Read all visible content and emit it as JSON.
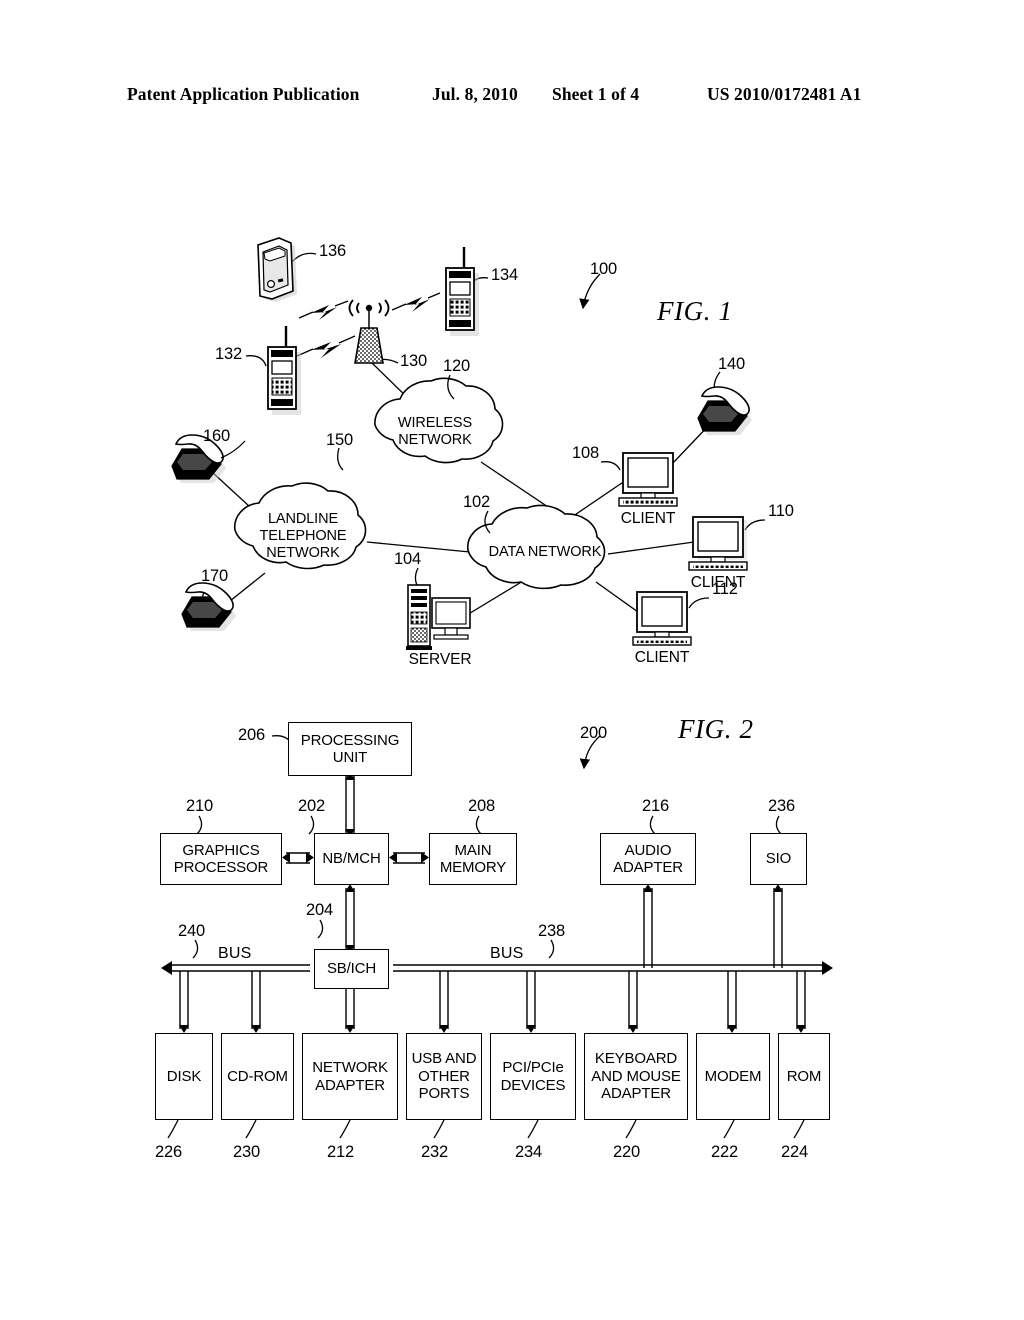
{
  "header": {
    "publication": "Patent Application Publication",
    "date": "Jul. 8, 2010",
    "sheet": "Sheet 1 of 4",
    "document_number": "US 2010/0172481 A1"
  },
  "figures": [
    {
      "id": "fig1",
      "title": "FIG. 1",
      "system_ref": "100",
      "clouds": [
        {
          "ref": "120",
          "lines": [
            "WIRELESS",
            "NETWORK"
          ]
        },
        {
          "ref": "150",
          "lines": [
            "LANDLINE",
            "TELEPHONE",
            "NETWORK"
          ]
        },
        {
          "ref": "102",
          "lines": [
            "DATA NETWORK"
          ]
        }
      ],
      "nodes": [
        {
          "ref": "136",
          "icon": "pda-icon",
          "caption": ""
        },
        {
          "ref": "134",
          "icon": "cell-phone-icon",
          "caption": ""
        },
        {
          "ref": "132",
          "icon": "cell-phone-icon",
          "caption": ""
        },
        {
          "ref": "130",
          "icon": "cell-tower-icon",
          "caption": ""
        },
        {
          "ref": "160",
          "icon": "desk-phone-icon",
          "caption": ""
        },
        {
          "ref": "170",
          "icon": "desk-phone-icon",
          "caption": ""
        },
        {
          "ref": "140",
          "icon": "desk-phone-icon",
          "caption": ""
        },
        {
          "ref": "104",
          "icon": "server-icon",
          "caption": "SERVER"
        },
        {
          "ref": "108",
          "icon": "client-computer-icon",
          "caption": "CLIENT"
        },
        {
          "ref": "110",
          "icon": "client-computer-icon",
          "caption": "CLIENT"
        },
        {
          "ref": "112",
          "icon": "client-computer-icon",
          "caption": "CLIENT"
        }
      ]
    },
    {
      "id": "fig2",
      "title": "FIG. 2",
      "system_ref": "200",
      "buses": [
        {
          "ref": "240",
          "label": "BUS"
        },
        {
          "ref": "238",
          "label": "BUS"
        }
      ],
      "boxes": [
        {
          "ref": "206",
          "lines": [
            "PROCESSING",
            "UNIT"
          ]
        },
        {
          "ref": "210",
          "lines": [
            "GRAPHICS",
            "PROCESSOR"
          ]
        },
        {
          "ref": "202",
          "lines": [
            "NB/MCH"
          ]
        },
        {
          "ref": "208",
          "lines": [
            "MAIN",
            "MEMORY"
          ]
        },
        {
          "ref": "216",
          "lines": [
            "AUDIO",
            "ADAPTER"
          ]
        },
        {
          "ref": "236",
          "lines": [
            "SIO"
          ]
        },
        {
          "ref": "204",
          "lines": [
            "SB/ICH"
          ]
        },
        {
          "ref": "226",
          "lines": [
            "DISK"
          ]
        },
        {
          "ref": "230",
          "lines": [
            "CD-ROM"
          ]
        },
        {
          "ref": "212",
          "lines": [
            "NETWORK",
            "ADAPTER"
          ]
        },
        {
          "ref": "232",
          "lines": [
            "USB AND",
            "OTHER",
            "PORTS"
          ]
        },
        {
          "ref": "234",
          "lines": [
            "PCI/PCIe",
            "DEVICES"
          ]
        },
        {
          "ref": "220",
          "lines": [
            "KEYBOARD",
            "AND MOUSE",
            "ADAPTER"
          ]
        },
        {
          "ref": "222",
          "lines": [
            "MODEM"
          ]
        },
        {
          "ref": "224",
          "lines": [
            "ROM"
          ]
        }
      ]
    }
  ],
  "fig1_text": {
    "wireless_l1": "WIRELESS",
    "wireless_l2": "NETWORK",
    "landline_l1": "LANDLINE",
    "landline_l2": "TELEPHONE",
    "landline_l3": "NETWORK",
    "data_network": "DATA NETWORK",
    "server_caption": "SERVER",
    "client_108_caption": "CLIENT",
    "client_110_caption": "CLIENT",
    "client_112_caption": "CLIENT",
    "ref_100": "100",
    "ref_102": "102",
    "ref_104": "104",
    "ref_108": "108",
    "ref_110": "110",
    "ref_112": "112",
    "ref_120": "120",
    "ref_130": "130",
    "ref_132": "132",
    "ref_134": "134",
    "ref_136": "136",
    "ref_140": "140",
    "ref_150": "150",
    "ref_160": "160",
    "ref_170": "170"
  },
  "fig2_text": {
    "ref_200": "200",
    "ref_202": "202",
    "ref_204": "204",
    "ref_206": "206",
    "ref_208": "208",
    "ref_210": "210",
    "ref_212": "212",
    "ref_216": "216",
    "ref_220": "220",
    "ref_222": "222",
    "ref_224": "224",
    "ref_226": "226",
    "ref_230": "230",
    "ref_232": "232",
    "ref_234": "234",
    "ref_236": "236",
    "ref_238": "238",
    "ref_240": "240",
    "bus_left_label": "BUS",
    "bus_right_label": "BUS",
    "processing_unit_l1": "PROCESSING",
    "processing_unit_l2": "UNIT",
    "graphics_l1": "GRAPHICS",
    "graphics_l2": "PROCESSOR",
    "nbmch": "NB/MCH",
    "main_memory_l1": "MAIN",
    "main_memory_l2": "MEMORY",
    "audio_l1": "AUDIO",
    "audio_l2": "ADAPTER",
    "sio": "SIO",
    "sbich": "SB/ICH",
    "disk": "DISK",
    "cdrom": "CD-ROM",
    "network_adapter_l1": "NETWORK",
    "network_adapter_l2": "ADAPTER",
    "usb_l1": "USB AND",
    "usb_l2": "OTHER",
    "usb_l3": "PORTS",
    "pci_l1": "PCI/PCIe",
    "pci_l2": "DEVICES",
    "kbm_l1": "KEYBOARD",
    "kbm_l2": "AND MOUSE",
    "kbm_l3": "ADAPTER",
    "modem": "MODEM",
    "rom": "ROM"
  },
  "colors": {
    "ink": "#000000",
    "paper": "#ffffff",
    "shadow": "#b9b9b9"
  }
}
